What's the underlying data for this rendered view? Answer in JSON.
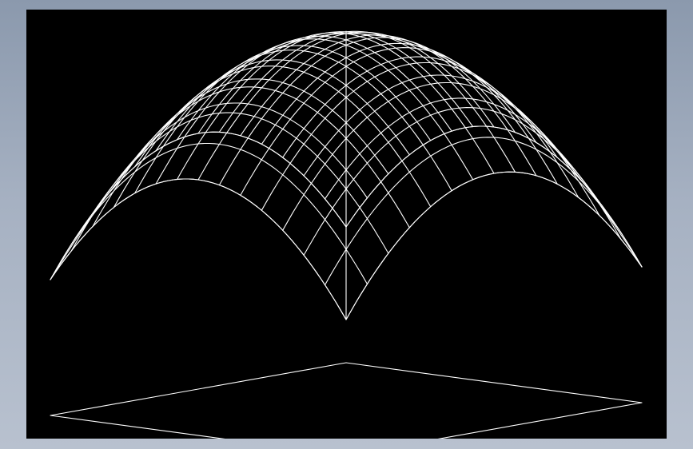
{
  "scene": {
    "background_color": "#000000",
    "frame_color": "#9aa6b8",
    "line_color": "#ffffff",
    "objects": [
      {
        "name": "dome-wireframe",
        "kind": "dome lattice"
      },
      {
        "name": "ground-plane",
        "kind": "base quadrilateral"
      }
    ]
  }
}
